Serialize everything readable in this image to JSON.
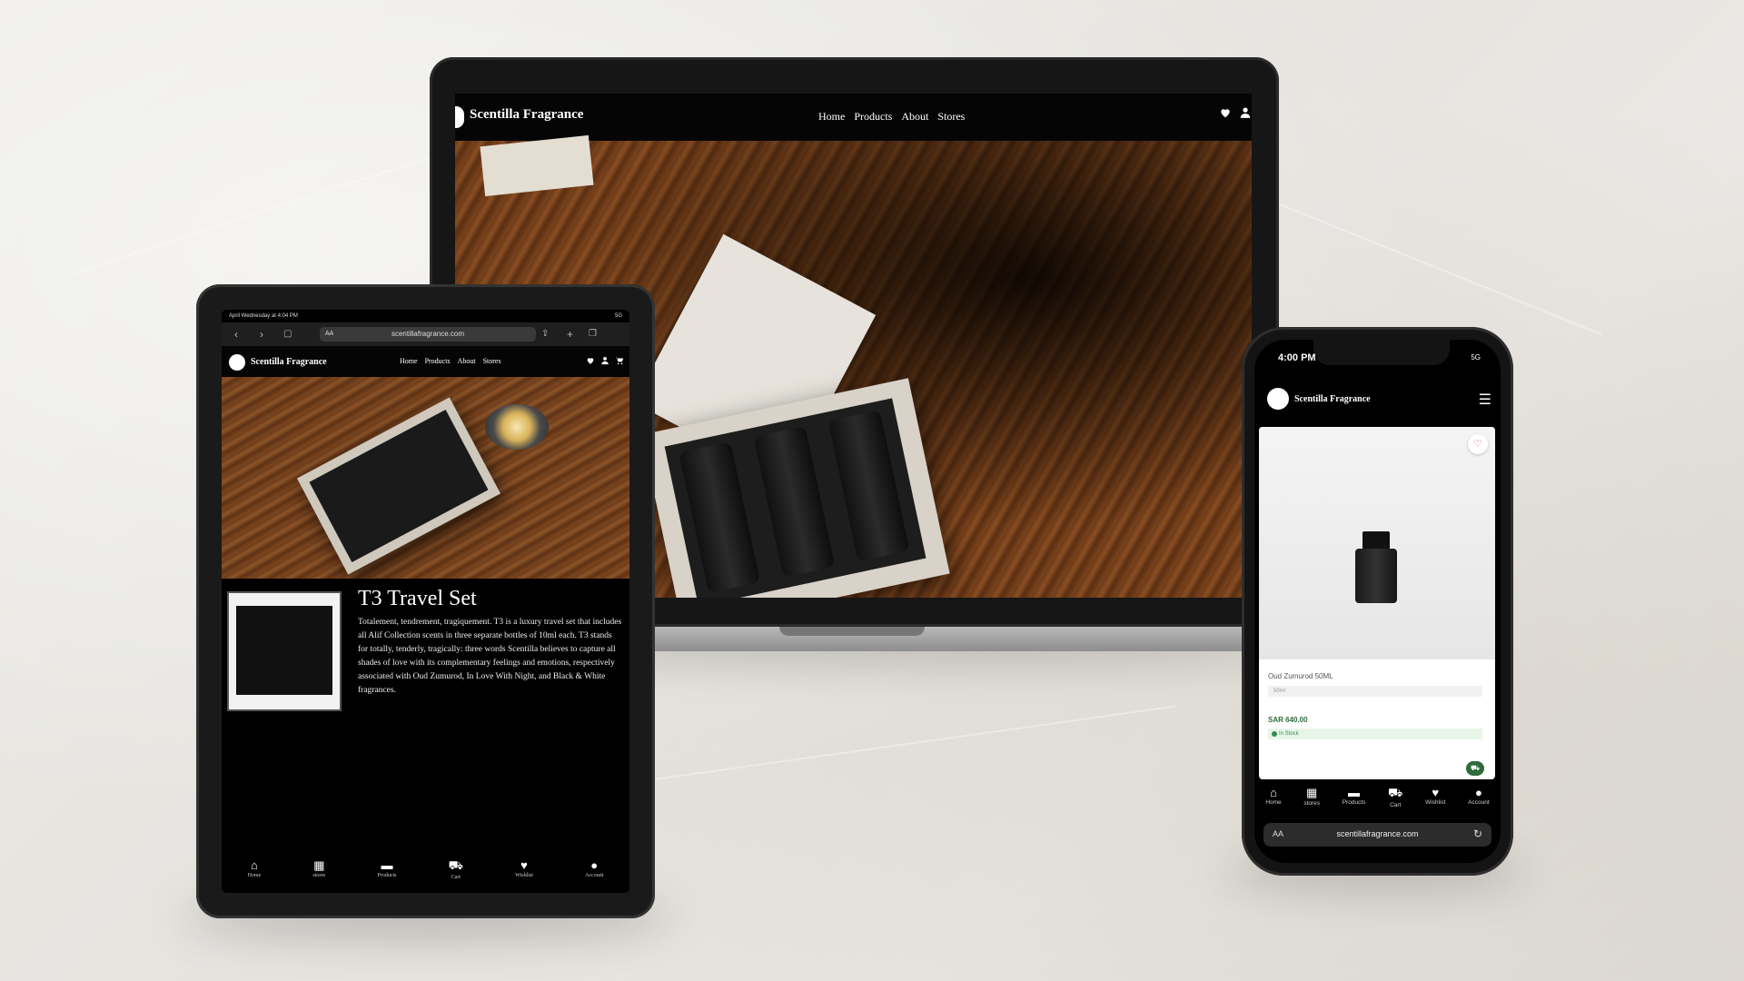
{
  "brand": "Scentilla Fragrance",
  "laptop": {
    "nav_links": [
      "Home",
      "Products",
      "About",
      "Stores"
    ]
  },
  "tablet": {
    "status_left": "April Wednesday at 4:04 PM",
    "status_right": "5G",
    "url_text_size": "AA",
    "url": "scentillafragrance.com",
    "nav_links": [
      "Home",
      "Products",
      "About",
      "Stores"
    ],
    "product_title": "T3 Travel Set",
    "product_description": "Totalement, tendrement, tragiquement. T3 is a luxury travel set that includes all Alif Collection scents in three separate bottles of 10ml each. T3 stands for totally, tenderly, tragically: three words Scentilla believes to capture all shades of love with its complementary feelings and emotions, respectively associated with Oud Zumurod, In Love With Night, and Black & White fragrances.",
    "bottom_tabs": [
      "Home",
      "stores",
      "Products",
      "Cart",
      "Wishlist",
      "Account"
    ]
  },
  "phone": {
    "time": "4:00 PM",
    "network": "5G",
    "product_name": "Oud Zumurod 50ML",
    "size": "50ml",
    "price": "SAR 640.00",
    "stock": "In Stock",
    "bottom_tabs": [
      "Home",
      "stores",
      "Products",
      "Cart",
      "Wishlist",
      "Account"
    ],
    "url_text_size": "AA",
    "url": "scentillafragrance.com"
  },
  "icons": {
    "heart": "heart-icon",
    "user": "user-icon",
    "cart": "cart-icon",
    "home": "home-icon",
    "map": "map-icon",
    "box": "box-icon",
    "menu": "menu-icon",
    "reload": "reload-icon"
  }
}
